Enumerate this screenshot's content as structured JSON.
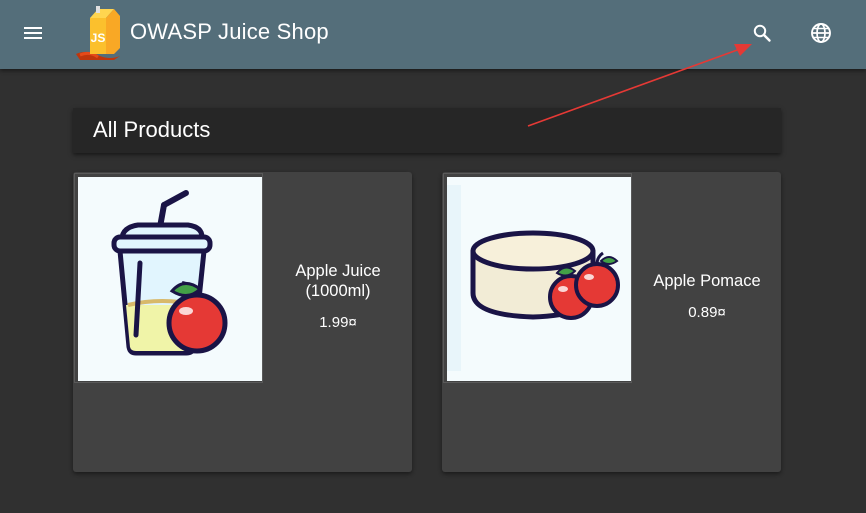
{
  "header": {
    "title": "OWASP Juice Shop",
    "logo_text": "JS",
    "menu_icon": "menu-icon",
    "search_icon": "search-icon",
    "language_icon": "language-icon",
    "color": "#546e7a"
  },
  "main": {
    "heading": "All Products",
    "products": [
      {
        "name_line1": "Apple Juice",
        "name_line2": "(1000ml)",
        "price": "1.99¤",
        "image": "apple-juice-image"
      },
      {
        "name_line1": "Apple Pomace",
        "name_line2": "",
        "price": "0.89¤",
        "image": "apple-pomace-image"
      }
    ]
  },
  "colors": {
    "background": "#303030",
    "card": "#424242",
    "heading_bar": "#262626",
    "annotation": "#e53935"
  }
}
